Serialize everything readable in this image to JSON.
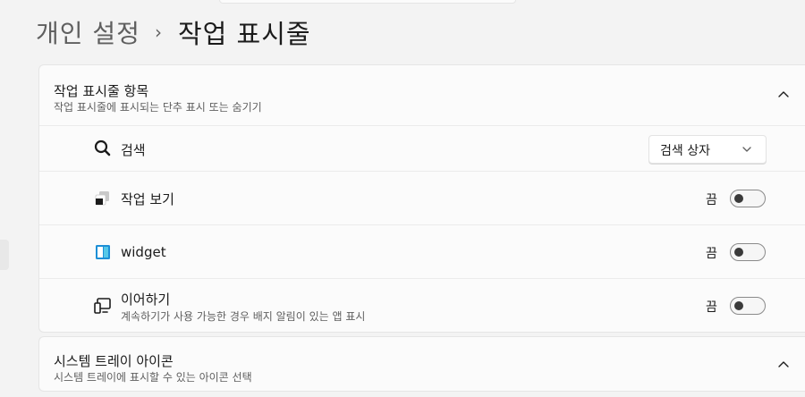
{
  "breadcrumb": {
    "parent": "개인 설정",
    "separator": "›",
    "current": "작업 표시줄"
  },
  "taskbar_items_section": {
    "title": "작업 표시줄 항목",
    "subtitle": "작업 표시줄에 표시되는 단추 표시 또는 숨기기",
    "expanded": true,
    "rows": [
      {
        "icon": "search-icon",
        "label": "검색",
        "control": "dropdown",
        "value": "검색 상자"
      },
      {
        "icon": "task-view-icon",
        "label": "작업 보기",
        "control": "toggle",
        "state_label": "끔",
        "on": false
      },
      {
        "icon": "widget-icon",
        "label": "widget",
        "control": "toggle",
        "state_label": "끔",
        "on": false
      },
      {
        "icon": "continuity-icon",
        "label": "이어하기",
        "sublabel": "계속하기가 사용 가능한 경우 배지 알림이 있는 앱 표시",
        "control": "toggle",
        "state_label": "끔",
        "on": false
      }
    ]
  },
  "system_tray_section": {
    "title": "시스템 트레이 아이콘",
    "subtitle": "시스템 트레이에 표시할 수 있는 아이콘 선택"
  },
  "colors": {
    "page_bg": "#f3f3f3",
    "card_bg": "#fbfbfb",
    "border": "#e5e5e5",
    "widget_blue": "#1d8fd6",
    "widget_cyan": "#55c8e8"
  }
}
